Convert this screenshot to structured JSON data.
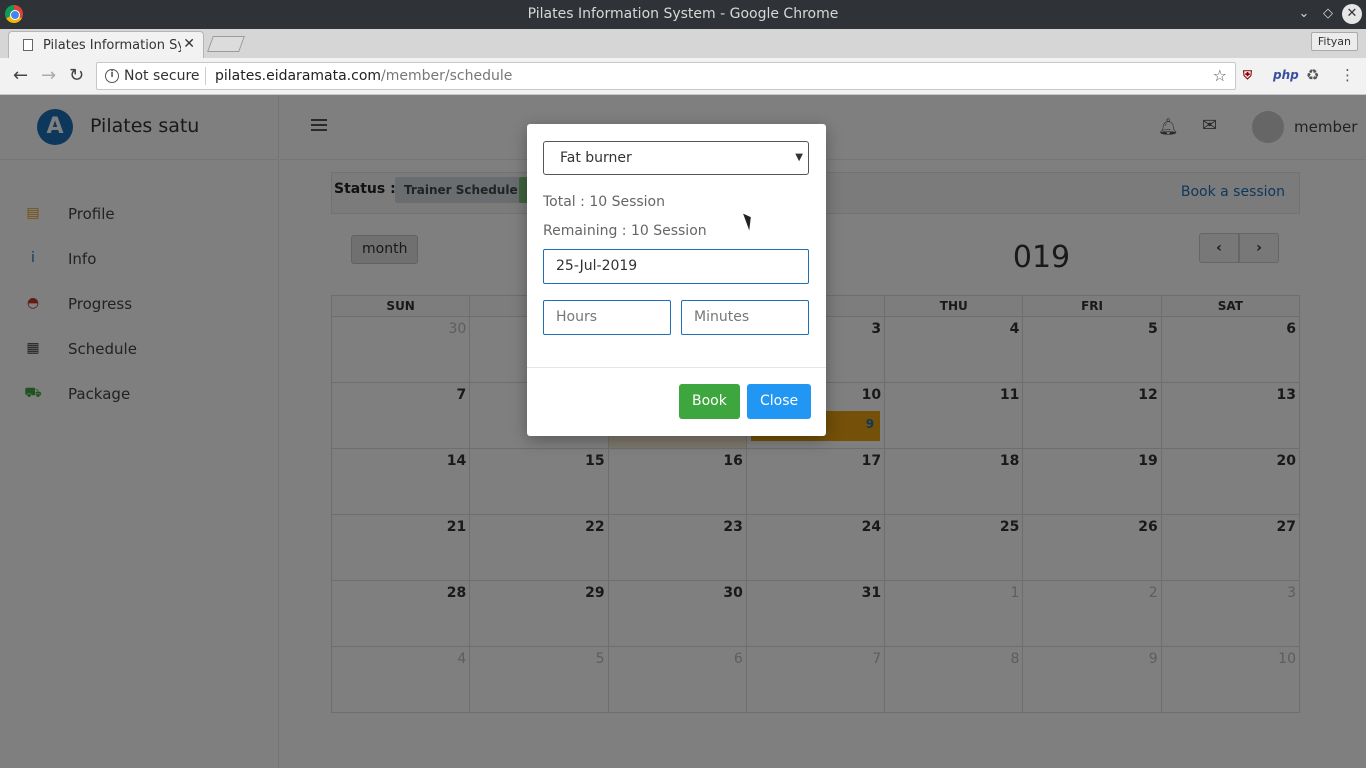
{
  "window": {
    "title": "Pilates Information System - Google Chrome"
  },
  "browser": {
    "tab_title": "Pilates Information System",
    "profile": "Fityan",
    "security": "Not secure",
    "url_host": "pilates.eidaramata.com",
    "url_path": "/member/schedule"
  },
  "app": {
    "brand": "Pilates satu",
    "logo_letter": "A",
    "username": "member",
    "sidebar": [
      {
        "label": "Profile",
        "icon": "profile-card-icon",
        "color": "#e8a110"
      },
      {
        "label": "Info",
        "icon": "info-icon",
        "color": "#1d6fb8"
      },
      {
        "label": "Progress",
        "icon": "speedometer-icon",
        "color": "#c0392b"
      },
      {
        "label": "Schedule",
        "icon": "calendar-icon",
        "color": "#444444"
      },
      {
        "label": "Package",
        "icon": "cart-icon",
        "color": "#3ea63e"
      }
    ]
  },
  "status": {
    "label": "Status :",
    "badge_trainer": "Trainer Schedule",
    "book_link": "Book a session"
  },
  "calendar": {
    "view_button": "month",
    "title_visible": "019",
    "prev": "‹",
    "next": "›",
    "weekdays": [
      "SUN",
      "",
      "",
      "D",
      "THU",
      "FRI",
      "SAT"
    ],
    "weeks": [
      [
        {
          "d": "30",
          "o": true
        },
        {
          "d": "",
          "o": false
        },
        {
          "d": "",
          "o": false
        },
        {
          "d": "3",
          "o": false
        },
        {
          "d": "4",
          "o": false
        },
        {
          "d": "5",
          "o": false
        },
        {
          "d": "6",
          "o": false
        }
      ],
      [
        {
          "d": "7",
          "o": false
        },
        {
          "d": "",
          "o": false
        },
        {
          "d": "",
          "o": false
        },
        {
          "d": "10",
          "o": false
        },
        {
          "d": "11",
          "o": false
        },
        {
          "d": "12",
          "o": false
        },
        {
          "d": "13",
          "o": false
        }
      ],
      [
        {
          "d": "14",
          "o": false
        },
        {
          "d": "15",
          "o": false
        },
        {
          "d": "16",
          "o": false
        },
        {
          "d": "17",
          "o": false
        },
        {
          "d": "18",
          "o": false
        },
        {
          "d": "19",
          "o": false
        },
        {
          "d": "20",
          "o": false
        }
      ],
      [
        {
          "d": "21",
          "o": false
        },
        {
          "d": "22",
          "o": false
        },
        {
          "d": "23",
          "o": false
        },
        {
          "d": "24",
          "o": false
        },
        {
          "d": "25",
          "o": false
        },
        {
          "d": "26",
          "o": false
        },
        {
          "d": "27",
          "o": false
        }
      ],
      [
        {
          "d": "28",
          "o": false
        },
        {
          "d": "29",
          "o": false
        },
        {
          "d": "30",
          "o": false
        },
        {
          "d": "31",
          "o": false
        },
        {
          "d": "1",
          "o": true
        },
        {
          "d": "2",
          "o": true
        },
        {
          "d": "3",
          "o": true
        }
      ],
      [
        {
          "d": "4",
          "o": true
        },
        {
          "d": "5",
          "o": true
        },
        {
          "d": "6",
          "o": true
        },
        {
          "d": "7",
          "o": true
        },
        {
          "d": "8",
          "o": true
        },
        {
          "d": "9",
          "o": true
        },
        {
          "d": "10",
          "o": true
        }
      ]
    ],
    "event_label": "9"
  },
  "modal": {
    "package_selected": "Fat burner",
    "total": "Total : 10 Session",
    "remaining": "Remaining : 10 Session",
    "date_value": "25-Jul-2019",
    "hours_placeholder": "Hours",
    "minutes_placeholder": "Minutes",
    "book_label": "Book",
    "close_label": "Close"
  }
}
